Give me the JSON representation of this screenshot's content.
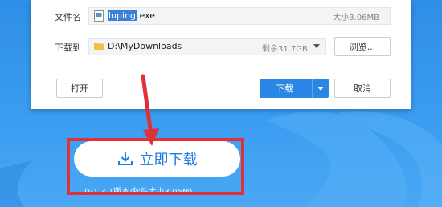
{
  "dialog": {
    "filename_label": "文件名",
    "filename_selected": "luping",
    "filename_ext": ".exe",
    "size_text": "大小3.06MB",
    "save_to_label": "下载到",
    "path": "D:\\MyDownloads",
    "free_space": "剩余31.7GB",
    "browse_label": "浏览...",
    "open_label": "打开",
    "download_label": "下载",
    "cancel_label": "取消"
  },
  "page": {
    "download_now_label": "立即下载",
    "version_text": "(V1.3.1版本/软件大小3.05M)"
  },
  "colors": {
    "background": "#3a9cf0",
    "primary": "#2a86e5",
    "highlight": "#e0303a"
  },
  "icons": [
    "file-icon",
    "folder-icon",
    "download-icon",
    "dropdown-caret-icon"
  ]
}
